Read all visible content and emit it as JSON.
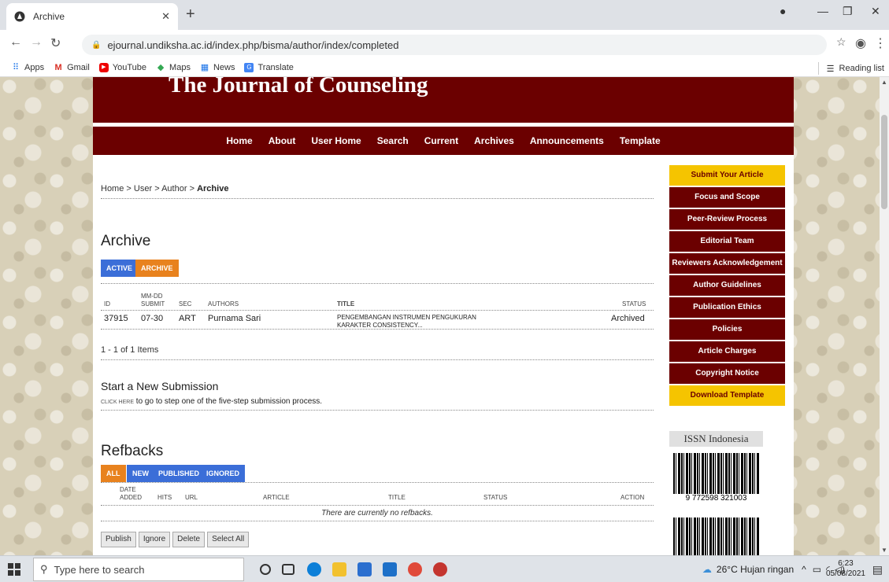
{
  "browser": {
    "tab_title": "Archive",
    "url": "ejournal.undiksha.ac.id/index.php/bisma/author/index/completed",
    "bookmarks": [
      "Apps",
      "Gmail",
      "YouTube",
      "Maps",
      "News",
      "Translate"
    ],
    "reading_list": "Reading list"
  },
  "site": {
    "journal_title": "The Journal of Counseling",
    "nav": [
      "Home",
      "About",
      "User Home",
      "Search",
      "Current",
      "Archives",
      "Announcements",
      "Template"
    ]
  },
  "breadcrumb": {
    "home": "Home",
    "user": "User",
    "author": "Author",
    "current": "Archive",
    "sep": ">"
  },
  "archive": {
    "heading": "Archive",
    "tabs": {
      "active": "ACTIVE",
      "archive": "ARCHIVE"
    },
    "columns": {
      "id": "ID",
      "submit_top": "MM-DD",
      "submit_bottom": "SUBMIT",
      "sec": "SEC",
      "authors": "AUTHORS",
      "title": "TITLE",
      "status": "STATUS"
    },
    "row": {
      "id": "37915",
      "submit": "07-30",
      "sec": "ART",
      "author": "Purnama Sari",
      "title": "PENGEMBANGAN INSTRUMEN PENGUKURAN KARAKTER CONSISTENCY...",
      "status": "Archived"
    },
    "items": "1 - 1 of 1 Items"
  },
  "new_submission": {
    "heading": "Start a New Submission",
    "link": "CLICK HERE",
    "text": "to go to step one of the five-step submission process."
  },
  "refbacks": {
    "heading": "Refbacks",
    "filters": [
      "ALL",
      "NEW",
      "PUBLISHED",
      "IGNORED"
    ],
    "columns": {
      "date_top": "DATE",
      "date_bottom": "ADDED",
      "hits": "HITS",
      "url": "URL",
      "article": "ARTICLE",
      "title": "TITLE",
      "status": "STATUS",
      "action": "ACTION"
    },
    "empty": "There are currently no refbacks.",
    "buttons": [
      "Publish",
      "Ignore",
      "Delete",
      "Select All"
    ]
  },
  "sidebar": {
    "items": [
      {
        "label": "Submit Your Article",
        "highlight": true
      },
      {
        "label": "Focus and Scope",
        "highlight": false
      },
      {
        "label": "Peer-Review Process",
        "highlight": false
      },
      {
        "label": "Editorial Team",
        "highlight": false
      },
      {
        "label": "Reviewers Acknowledgement",
        "highlight": false
      },
      {
        "label": "Author Guidelines",
        "highlight": false
      },
      {
        "label": "Publication Ethics",
        "highlight": false
      },
      {
        "label": "Policies",
        "highlight": false
      },
      {
        "label": "Article Charges",
        "highlight": false
      },
      {
        "label": "Copyright Notice",
        "highlight": false
      },
      {
        "label": "Download Template",
        "highlight": true
      }
    ],
    "issn_label": "ISSN Indonesia",
    "barcode_number": "9 772598 321003"
  },
  "taskbar": {
    "search_placeholder": "Type here to search",
    "weather": "26°C  Hujan ringan",
    "time": "6:23",
    "date": "05/08/2021"
  },
  "colors": {
    "maroon": "#6b0000",
    "gold": "#f5c400",
    "blue_pill": "#3b6ed8",
    "orange_pill": "#e8821e"
  }
}
